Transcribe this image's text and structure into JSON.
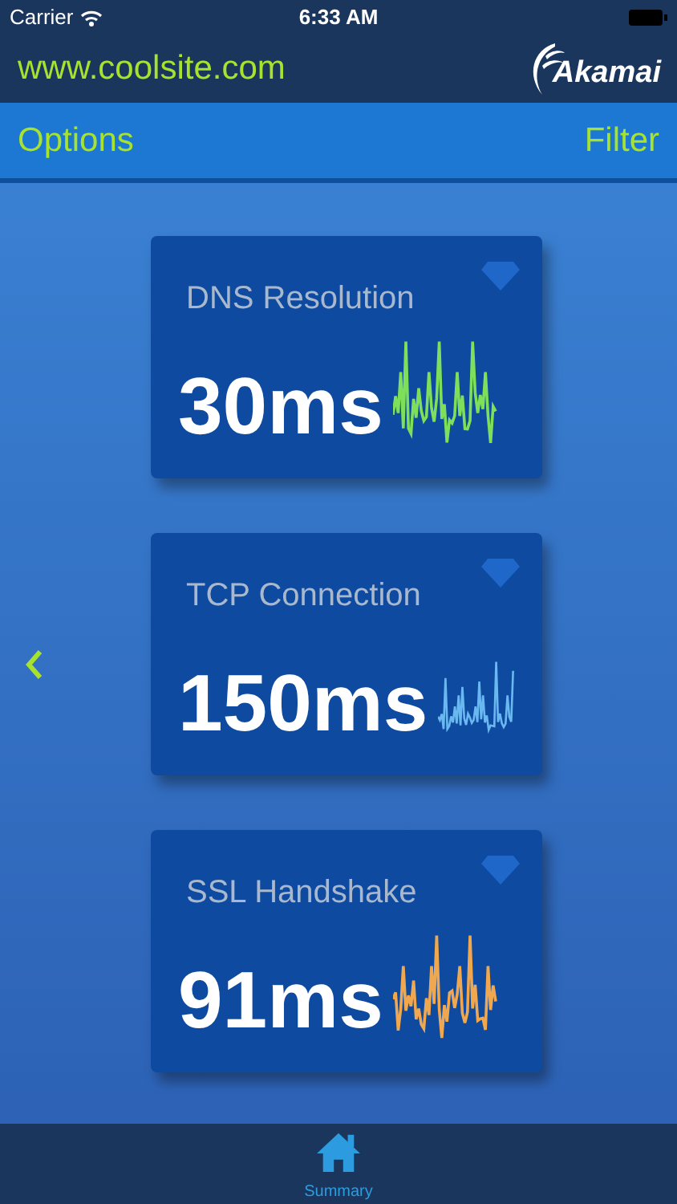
{
  "status_bar": {
    "carrier": "Carrier",
    "time": "6:33 AM"
  },
  "header": {
    "site": "www.coolsite.com",
    "logo": "Akamai"
  },
  "toolbar": {
    "left": "Options",
    "right": "Filter"
  },
  "metrics": [
    {
      "title": "DNS Resolution",
      "value": "30ms",
      "color": "#7ee05a"
    },
    {
      "title": "TCP Connection",
      "value": "150ms",
      "color": "#6ab8f0"
    },
    {
      "title": "SSL Handshake",
      "value": "91ms",
      "color": "#f0a850"
    }
  ],
  "tab_bar": [
    {
      "label": "Summary",
      "selected": true
    }
  ]
}
